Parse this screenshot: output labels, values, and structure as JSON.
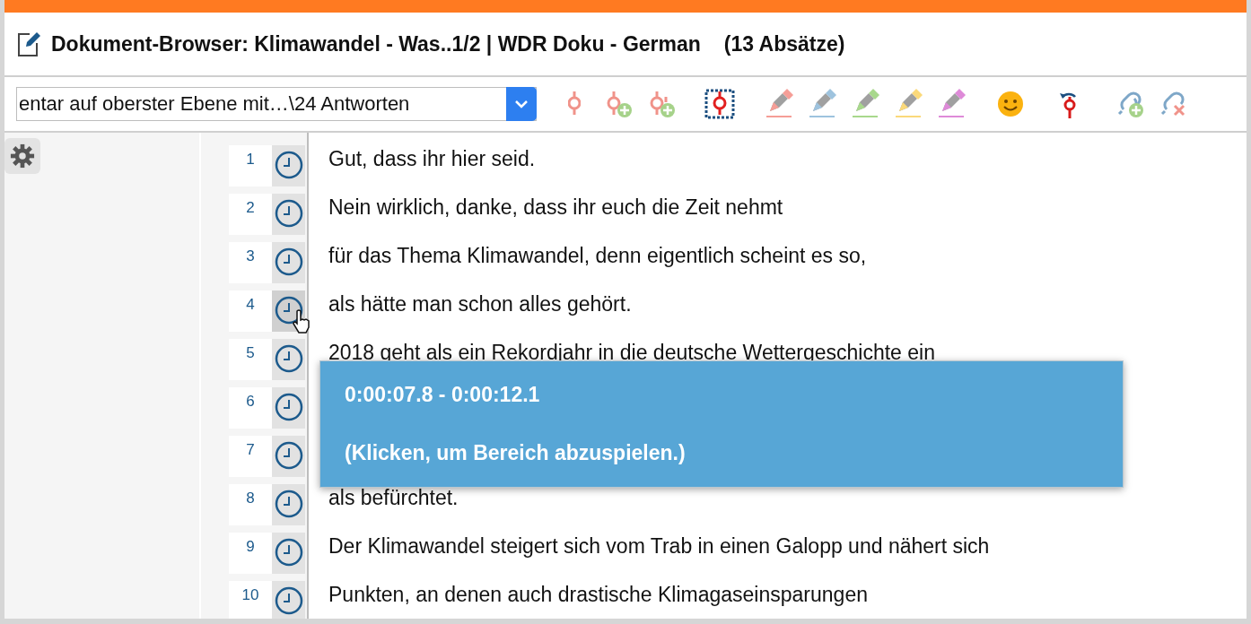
{
  "window": {
    "title": "Dokument-Browser: Klimawandel - Was..1/2 | WDR Doku - German",
    "count": "(13 Absätze)"
  },
  "toolbar": {
    "dropdown": {
      "value": "entar auf oberster Ebene mit…\\24 Antworten"
    }
  },
  "paragraphs": [
    {
      "number": "1",
      "text": "Gut, dass ihr hier seid.",
      "hovered": false
    },
    {
      "number": "2",
      "text": "Nein wirklich, danke, dass ihr euch die Zeit nehmt",
      "hovered": false
    },
    {
      "number": "3",
      "text": "für das Thema Klimawandel, denn eigentlich scheint es so,",
      "hovered": false
    },
    {
      "number": "4",
      "text": "als hätte man schon alles gehört.",
      "hovered": true
    },
    {
      "number": "5",
      "text": "2018 geht als ein Rekordjahr in die deutsche Wettergeschichte ein",
      "hovered": false
    },
    {
      "number": "6",
      "hovered": false
    },
    {
      "number": "7",
      "hovered": false
    },
    {
      "number": "8",
      "text": "als befürchtet.",
      "hovered": false
    },
    {
      "number": "9",
      "text": "Der Klimawandel steigert sich vom Trab in einen Galopp und nähert sich",
      "hovered": false
    },
    {
      "number": "10",
      "text": "Punkten, an denen auch drastische Klimagaseinsparungen",
      "hovered": false
    }
  ],
  "tooltip": {
    "time_range": "0:00:07.8 - 0:00:12.1",
    "hint": "(Klicken, um Bereich abzuspielen.)"
  }
}
